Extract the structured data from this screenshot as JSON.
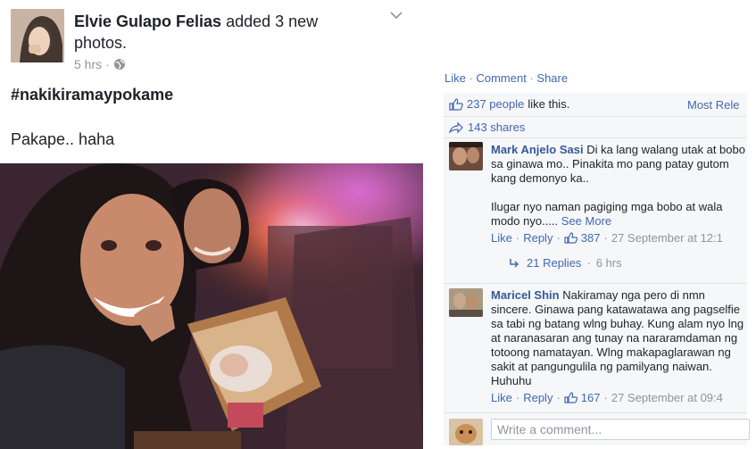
{
  "post": {
    "author": "Elvie Gulapo Felias",
    "action_text": "added 3 new photos.",
    "time": "5 hrs",
    "separator": "·",
    "hashtag": "#nakikiramaypokame",
    "caption": "Pakape.. haha"
  },
  "actions_bar": {
    "like": "Like",
    "dot1": "·",
    "comment": "Comment",
    "dot2": "·",
    "share": "Share"
  },
  "reactions": {
    "count": "237 people",
    "suffix": "like this.",
    "sort": "Most Rele",
    "shares": "143 shares"
  },
  "comments": [
    {
      "author": "Mark Anjelo Sasi",
      "text1": "Di ka lang walang utak at bobo sa ginawa mo.. Pinakita mo pang patay gutom kang demonyo ka..",
      "text2": "Ilugar nyo naman pagiging mga bobo at wala modo nyo.....",
      "see_more": "See More",
      "like": "Like",
      "reply": "Reply",
      "likes": "387",
      "time": "27 September at 12:1",
      "replies": "21 Replies",
      "replies_time": "6 hrs"
    },
    {
      "author": "Maricel Shin",
      "text": "Nakiramay nga pero di nmn sincere. Ginawa pang katawatawa ang pagselfie sa tabi ng batang wlng buhay. Kung alam nyo lng at naranasaran ang tunay na nararamdaman ng totoong namatayan. Wlng makapaglarawan ng sakit at pangungulila ng pamilyang naiwan. Huhuhu",
      "like": "Like",
      "reply": "Reply",
      "likes": "167",
      "time": "27 September at 09:4"
    }
  ],
  "composer": {
    "placeholder": "Write a comment..."
  },
  "colors": {
    "link": "#4267b2",
    "name_blue": "#365899",
    "panel_bg": "#f6f7f9"
  }
}
